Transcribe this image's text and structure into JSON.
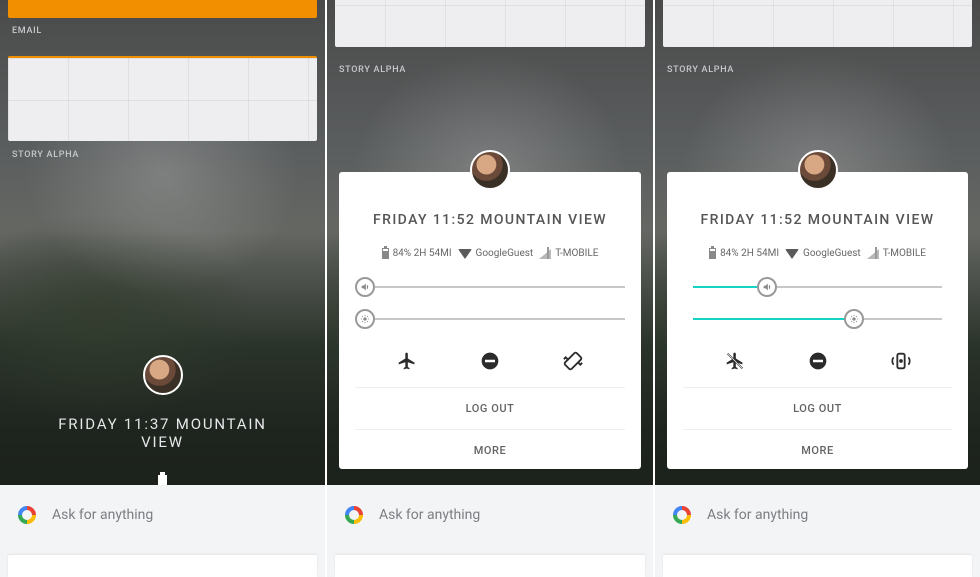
{
  "screen1": {
    "label_email": "EMAIL",
    "label_story": "STORY ALPHA",
    "datetime": "FRIDAY 11:37 MOUNTAIN VIEW",
    "search_placeholder": "Ask for anything"
  },
  "screen2": {
    "label_story": "STORY ALPHA",
    "datetime": "FRIDAY 11:52 MOUNTAIN VIEW",
    "battery": "84% 2H 54MI",
    "wifi": "GoogleGuest",
    "cell": "T-MOBILE",
    "volume_pct": 0,
    "brightness_pct": 0,
    "logout": "LOG OUT",
    "more": "MORE",
    "search_placeholder": "Ask for anything"
  },
  "screen3": {
    "label_story": "STORY ALPHA",
    "datetime": "FRIDAY 11:52 MOUNTAIN VIEW",
    "battery": "84% 2H 54MI",
    "wifi": "GoogleGuest",
    "cell": "T-MOBILE",
    "volume_pct": 28,
    "brightness_pct": 66,
    "logout": "LOG OUT",
    "more": "MORE",
    "search_placeholder": "Ask for anything"
  },
  "colors": {
    "accent_orange": "#f18f00",
    "slider_fill": "#14d3c4"
  }
}
